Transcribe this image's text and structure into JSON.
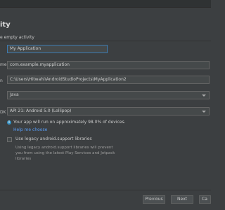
{
  "header": {
    "title": "ity",
    "subtitle": "e empty activity"
  },
  "form": {
    "name_value": "My Application",
    "package_label": "me",
    "package_value": "com.example.myapplication",
    "save_location_value": "C:\\Users\\Hitwahi\\AndroidStudioProjects\\MyApplication2",
    "language_value": "Java",
    "min_sdk_label": "DK",
    "min_sdk_value": "API 21: Android 5.0 (Lollipop)"
  },
  "info": {
    "text": "Your app will run on approximately 98.0% of devices.",
    "help_link": "Help me choose"
  },
  "legacy": {
    "checkbox_label": "Use legacy android.support libraries",
    "description": "Using legacy android.support libraries will prevent you from using the latest Play Services and Jetpack libraries"
  },
  "footer": {
    "previous": "Previous",
    "next": "Next",
    "cancel": "Ca"
  },
  "colors": {
    "background": "#3c3f41",
    "focus_border": "#3d7bb1",
    "link": "#589df6"
  }
}
